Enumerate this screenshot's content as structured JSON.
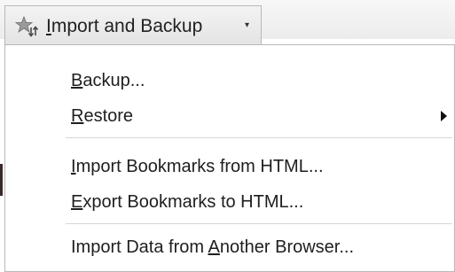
{
  "toolbar": {
    "button": {
      "label_first": "I",
      "label_rest": "mport and Backup",
      "arrow": "▾",
      "icon": "star-arrows-icon"
    }
  },
  "menu": {
    "items": [
      {
        "u": "B",
        "rest": "ackup...",
        "enabled": true
      },
      {
        "u": "R",
        "rest": "estore",
        "enabled": true,
        "submenu": true
      },
      {
        "u": "I",
        "rest": "mport Bookmarks from HTML...",
        "enabled": true
      },
      {
        "u": "E",
        "rest": "xport Bookmarks to HTML...",
        "enabled": true
      },
      {
        "pre": "Import Data from ",
        "u": "A",
        "rest": "nother Browser...",
        "enabled": true
      }
    ]
  }
}
